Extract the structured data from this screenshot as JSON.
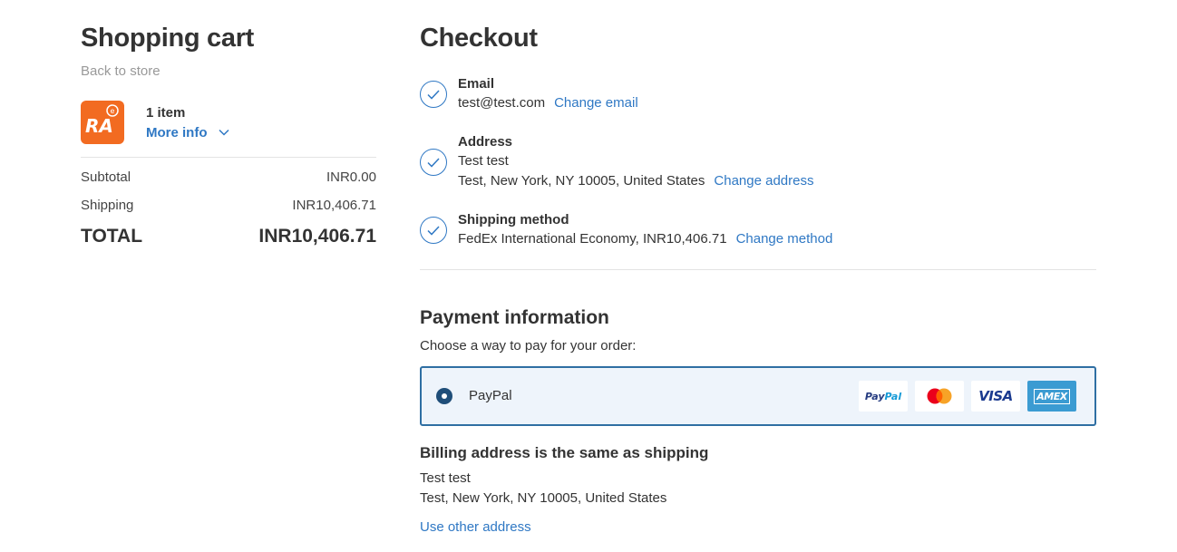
{
  "cart": {
    "title": "Shopping cart",
    "back_link": "Back to store",
    "item_count": "1 item",
    "more_info": "More info",
    "subtotal_label": "Subtotal",
    "subtotal_value": "INR0.00",
    "shipping_label": "Shipping",
    "shipping_value": "INR10,406.71",
    "total_label": "TOTAL",
    "total_value": "INR10,406.71",
    "logo_icon": "store-logo-icon",
    "logo_color": "#f26b21"
  },
  "checkout": {
    "title": "Checkout",
    "email": {
      "label": "Email",
      "value": "test@test.com",
      "change": "Change email"
    },
    "address": {
      "label": "Address",
      "name": "Test test",
      "line": "Test, New York, NY 10005, United States",
      "change": "Change address"
    },
    "shipping": {
      "label": "Shipping method",
      "value": "FedEx International Economy, INR10,406.71",
      "change": "Change method"
    },
    "payment": {
      "title": "Payment information",
      "subtitle": "Choose a way to pay for your order:",
      "option_label": "PayPal",
      "cards": [
        "PayPal",
        "Mastercard",
        "VISA",
        "AMEX"
      ],
      "paypal_text_1": "Pay",
      "paypal_text_2": "Pal",
      "visa_text": "VISA",
      "amex_text": "AMEX"
    },
    "billing": {
      "title": "Billing address is the same as shipping",
      "name": "Test test",
      "line": "Test, New York, NY 10005, United States",
      "use_other": "Use other address"
    }
  },
  "colors": {
    "link": "#2f78c4",
    "selected_border": "#2f6fa3",
    "selected_bg": "#eef4fb"
  }
}
